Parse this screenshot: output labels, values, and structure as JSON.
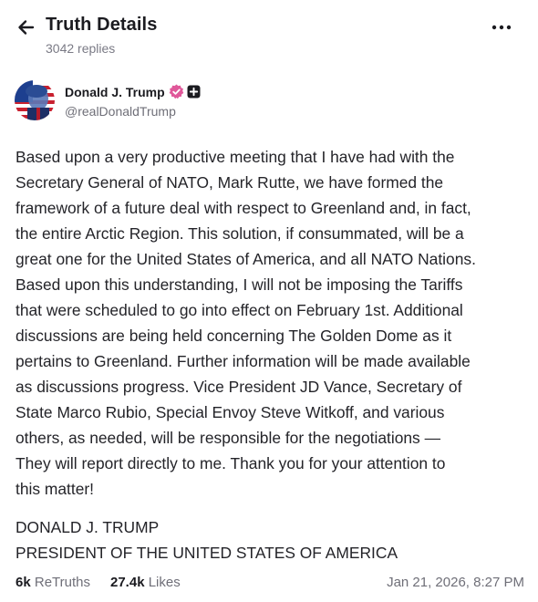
{
  "header": {
    "title": "Truth Details",
    "subtitle": "3042 replies",
    "back_icon": "arrow-left-icon",
    "more_icon": "more-horizontal-icon"
  },
  "author": {
    "name": "Donald J. Trump",
    "handle": "@realDonaldTrump",
    "verified_color": "#e0589a"
  },
  "post": {
    "lines": [
      "Based upon a very productive meeting that I have had with the",
      "Secretary General of NATO, Mark Rutte, we have formed the",
      "framework of a future deal with respect to Greenland and, in fact,",
      "the entire Arctic Region. This solution, if consummated, will be a",
      "great one for the United States of America, and all NATO Nations.",
      "Based upon this understanding, I will not be imposing the Tariffs",
      "that were scheduled to go into effect on February 1st. Additional",
      "discussions are being held concerning The Golden Dome as it",
      "pertains to Greenland. Further information will be made available",
      "as discussions progress. Vice President JD Vance, Secretary of",
      "State Marco Rubio, Special Envoy Steve Witkoff, and various",
      "others, as needed, will be responsible for the negotiations —",
      "They will report directly to me. Thank you for your attention to",
      "this matter!"
    ],
    "signature_name": "DONALD J. TRUMP",
    "signature_title": "PRESIDENT OF THE UNITED STATES OF AMERICA"
  },
  "footer": {
    "retruths_count": "6k",
    "retruths_label": "ReTruths",
    "likes_count": "27.4k",
    "likes_label": "Likes",
    "timestamp": "Jan 21, 2026, 8:27 PM"
  }
}
